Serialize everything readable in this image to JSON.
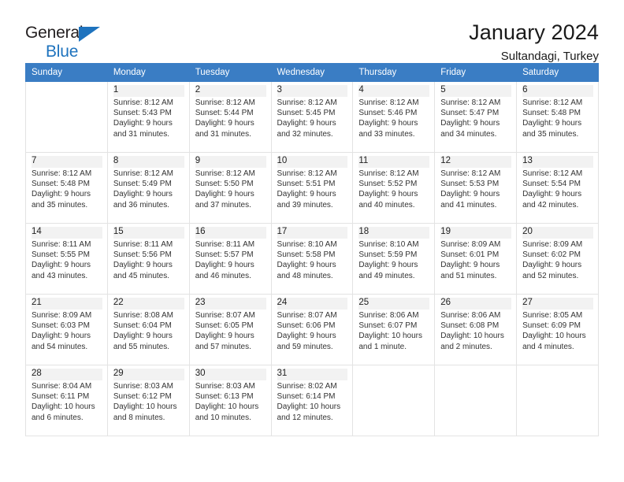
{
  "logo": {
    "line1": "General",
    "line2": "Blue",
    "triangle_color": "#1e73be"
  },
  "header": {
    "title": "January 2024",
    "subtitle": "Sultandagi, Turkey",
    "header_bg": "#3a7dc4"
  },
  "weekdays": [
    "Sunday",
    "Monday",
    "Tuesday",
    "Wednesday",
    "Thursday",
    "Friday",
    "Saturday"
  ],
  "weeks": [
    [
      {
        "day": "",
        "sunrise": "",
        "sunset": "",
        "daylight1": "",
        "daylight2": "",
        "empty": true
      },
      {
        "day": "1",
        "sunrise": "Sunrise: 8:12 AM",
        "sunset": "Sunset: 5:43 PM",
        "daylight1": "Daylight: 9 hours",
        "daylight2": "and 31 minutes."
      },
      {
        "day": "2",
        "sunrise": "Sunrise: 8:12 AM",
        "sunset": "Sunset: 5:44 PM",
        "daylight1": "Daylight: 9 hours",
        "daylight2": "and 31 minutes."
      },
      {
        "day": "3",
        "sunrise": "Sunrise: 8:12 AM",
        "sunset": "Sunset: 5:45 PM",
        "daylight1": "Daylight: 9 hours",
        "daylight2": "and 32 minutes."
      },
      {
        "day": "4",
        "sunrise": "Sunrise: 8:12 AM",
        "sunset": "Sunset: 5:46 PM",
        "daylight1": "Daylight: 9 hours",
        "daylight2": "and 33 minutes."
      },
      {
        "day": "5",
        "sunrise": "Sunrise: 8:12 AM",
        "sunset": "Sunset: 5:47 PM",
        "daylight1": "Daylight: 9 hours",
        "daylight2": "and 34 minutes."
      },
      {
        "day": "6",
        "sunrise": "Sunrise: 8:12 AM",
        "sunset": "Sunset: 5:48 PM",
        "daylight1": "Daylight: 9 hours",
        "daylight2": "and 35 minutes."
      }
    ],
    [
      {
        "day": "7",
        "sunrise": "Sunrise: 8:12 AM",
        "sunset": "Sunset: 5:48 PM",
        "daylight1": "Daylight: 9 hours",
        "daylight2": "and 35 minutes."
      },
      {
        "day": "8",
        "sunrise": "Sunrise: 8:12 AM",
        "sunset": "Sunset: 5:49 PM",
        "daylight1": "Daylight: 9 hours",
        "daylight2": "and 36 minutes."
      },
      {
        "day": "9",
        "sunrise": "Sunrise: 8:12 AM",
        "sunset": "Sunset: 5:50 PM",
        "daylight1": "Daylight: 9 hours",
        "daylight2": "and 37 minutes."
      },
      {
        "day": "10",
        "sunrise": "Sunrise: 8:12 AM",
        "sunset": "Sunset: 5:51 PM",
        "daylight1": "Daylight: 9 hours",
        "daylight2": "and 39 minutes."
      },
      {
        "day": "11",
        "sunrise": "Sunrise: 8:12 AM",
        "sunset": "Sunset: 5:52 PM",
        "daylight1": "Daylight: 9 hours",
        "daylight2": "and 40 minutes."
      },
      {
        "day": "12",
        "sunrise": "Sunrise: 8:12 AM",
        "sunset": "Sunset: 5:53 PM",
        "daylight1": "Daylight: 9 hours",
        "daylight2": "and 41 minutes."
      },
      {
        "day": "13",
        "sunrise": "Sunrise: 8:12 AM",
        "sunset": "Sunset: 5:54 PM",
        "daylight1": "Daylight: 9 hours",
        "daylight2": "and 42 minutes."
      }
    ],
    [
      {
        "day": "14",
        "sunrise": "Sunrise: 8:11 AM",
        "sunset": "Sunset: 5:55 PM",
        "daylight1": "Daylight: 9 hours",
        "daylight2": "and 43 minutes."
      },
      {
        "day": "15",
        "sunrise": "Sunrise: 8:11 AM",
        "sunset": "Sunset: 5:56 PM",
        "daylight1": "Daylight: 9 hours",
        "daylight2": "and 45 minutes."
      },
      {
        "day": "16",
        "sunrise": "Sunrise: 8:11 AM",
        "sunset": "Sunset: 5:57 PM",
        "daylight1": "Daylight: 9 hours",
        "daylight2": "and 46 minutes."
      },
      {
        "day": "17",
        "sunrise": "Sunrise: 8:10 AM",
        "sunset": "Sunset: 5:58 PM",
        "daylight1": "Daylight: 9 hours",
        "daylight2": "and 48 minutes."
      },
      {
        "day": "18",
        "sunrise": "Sunrise: 8:10 AM",
        "sunset": "Sunset: 5:59 PM",
        "daylight1": "Daylight: 9 hours",
        "daylight2": "and 49 minutes."
      },
      {
        "day": "19",
        "sunrise": "Sunrise: 8:09 AM",
        "sunset": "Sunset: 6:01 PM",
        "daylight1": "Daylight: 9 hours",
        "daylight2": "and 51 minutes."
      },
      {
        "day": "20",
        "sunrise": "Sunrise: 8:09 AM",
        "sunset": "Sunset: 6:02 PM",
        "daylight1": "Daylight: 9 hours",
        "daylight2": "and 52 minutes."
      }
    ],
    [
      {
        "day": "21",
        "sunrise": "Sunrise: 8:09 AM",
        "sunset": "Sunset: 6:03 PM",
        "daylight1": "Daylight: 9 hours",
        "daylight2": "and 54 minutes."
      },
      {
        "day": "22",
        "sunrise": "Sunrise: 8:08 AM",
        "sunset": "Sunset: 6:04 PM",
        "daylight1": "Daylight: 9 hours",
        "daylight2": "and 55 minutes."
      },
      {
        "day": "23",
        "sunrise": "Sunrise: 8:07 AM",
        "sunset": "Sunset: 6:05 PM",
        "daylight1": "Daylight: 9 hours",
        "daylight2": "and 57 minutes."
      },
      {
        "day": "24",
        "sunrise": "Sunrise: 8:07 AM",
        "sunset": "Sunset: 6:06 PM",
        "daylight1": "Daylight: 9 hours",
        "daylight2": "and 59 minutes."
      },
      {
        "day": "25",
        "sunrise": "Sunrise: 8:06 AM",
        "sunset": "Sunset: 6:07 PM",
        "daylight1": "Daylight: 10 hours",
        "daylight2": "and 1 minute."
      },
      {
        "day": "26",
        "sunrise": "Sunrise: 8:06 AM",
        "sunset": "Sunset: 6:08 PM",
        "daylight1": "Daylight: 10 hours",
        "daylight2": "and 2 minutes."
      },
      {
        "day": "27",
        "sunrise": "Sunrise: 8:05 AM",
        "sunset": "Sunset: 6:09 PM",
        "daylight1": "Daylight: 10 hours",
        "daylight2": "and 4 minutes."
      }
    ],
    [
      {
        "day": "28",
        "sunrise": "Sunrise: 8:04 AM",
        "sunset": "Sunset: 6:11 PM",
        "daylight1": "Daylight: 10 hours",
        "daylight2": "and 6 minutes."
      },
      {
        "day": "29",
        "sunrise": "Sunrise: 8:03 AM",
        "sunset": "Sunset: 6:12 PM",
        "daylight1": "Daylight: 10 hours",
        "daylight2": "and 8 minutes."
      },
      {
        "day": "30",
        "sunrise": "Sunrise: 8:03 AM",
        "sunset": "Sunset: 6:13 PM",
        "daylight1": "Daylight: 10 hours",
        "daylight2": "and 10 minutes."
      },
      {
        "day": "31",
        "sunrise": "Sunrise: 8:02 AM",
        "sunset": "Sunset: 6:14 PM",
        "daylight1": "Daylight: 10 hours",
        "daylight2": "and 12 minutes."
      },
      {
        "day": "",
        "sunrise": "",
        "sunset": "",
        "daylight1": "",
        "daylight2": "",
        "empty": true
      },
      {
        "day": "",
        "sunrise": "",
        "sunset": "",
        "daylight1": "",
        "daylight2": "",
        "empty": true
      },
      {
        "day": "",
        "sunrise": "",
        "sunset": "",
        "daylight1": "",
        "daylight2": "",
        "empty": true
      }
    ]
  ]
}
